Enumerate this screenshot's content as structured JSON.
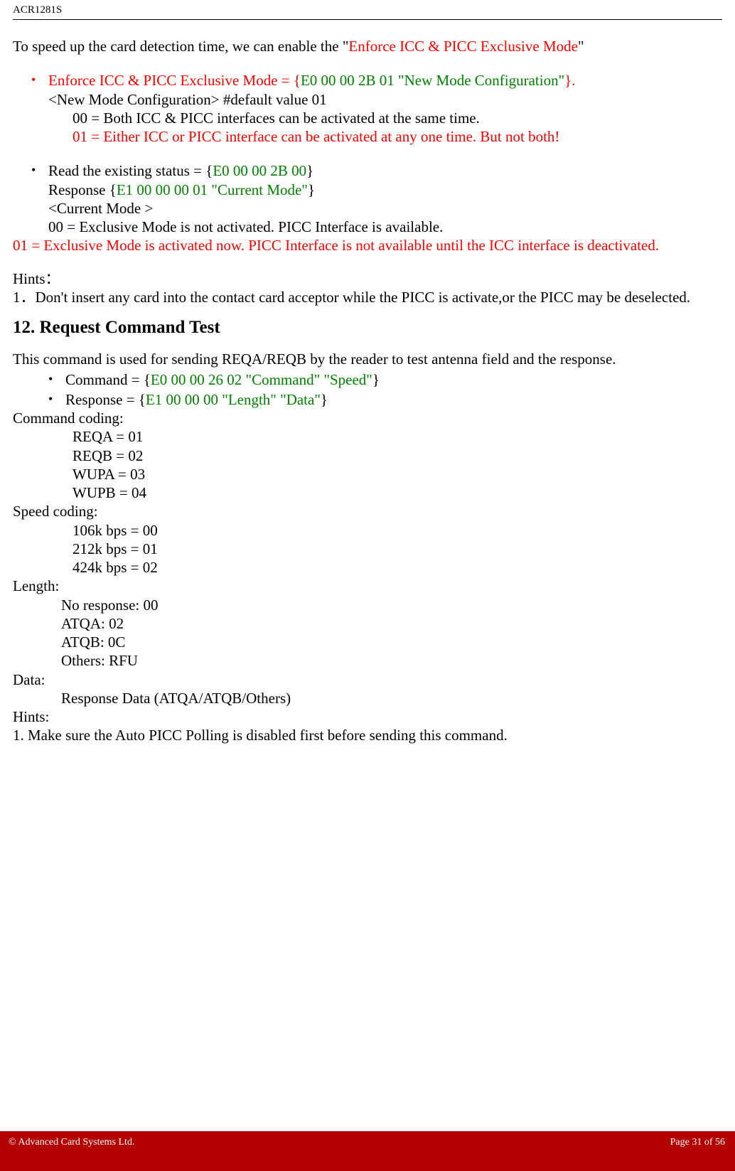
{
  "header": {
    "title": "ACR1281S"
  },
  "intro": {
    "prefix": "To speed up the card detection time, we can enable the \"",
    "mode_name": "Enforce ICC & PICC Exclusive Mode",
    "suffix": "\""
  },
  "b1": {
    "line1_red_a": "Enforce ICC & PICC Exclusive Mode = {",
    "line1_green": "E0 00 00 2B 01 \"New Mode Configuration\"",
    "line1_red_b": "}.",
    "conf_label": "<New Mode Configuration> #default value 01",
    "opt00": "00 = Both ICC & PICC interfaces can be activated at the same time.",
    "opt01": "01 = Either ICC or PICC interface can be activated at any one time. But not both!"
  },
  "b2": {
    "read_prefix": "Read the existing status = {",
    "read_code": "E0 00 00 2B 00",
    "read_suffix": "}",
    "resp_prefix": "Response {",
    "resp_code": "E1 00 00 00 01 \"Current Mode\"",
    "resp_suffix": "}",
    "cur_mode_label": "<Current Mode >",
    "opt00": "00 = Exclusive Mode is not activated. PICC Interface is available.",
    "opt01": "01 = Exclusive Mode is activated now. PICC Interface is not available until the ICC interface is deactivated."
  },
  "hints1": {
    "title": "Hints：",
    "item1": "1．Don't insert any card into the contact card acceptor while the PICC is activate,or the PICC may be deselected."
  },
  "section12": {
    "title": "12. Request Command Test",
    "intro": "This command is used for sending REQA/REQB by the reader to test antenna field and the response.",
    "cmd_prefix": "Command = {",
    "cmd_code": "E0 00 00 26 02 \"Command\" \"Speed\"",
    "cmd_suffix": "}",
    "resp_prefix": "Response = {",
    "resp_code": "E1 00 00 00 \"Length\" \"Data\"",
    "resp_suffix": "}",
    "cmd_coding_label": "Command coding:",
    "cmd_coding": [
      "REQA = 01",
      "REQB = 02",
      "WUPA = 03",
      "WUPB = 04"
    ],
    "speed_label": "Speed coding:",
    "speed_coding": [
      "106k bps = 00",
      "212k bps = 01",
      "424k bps = 02"
    ],
    "length_label": "Length:",
    "length_items": [
      "No response: 00",
      "ATQA: 02",
      "ATQB: 0C",
      "Others: RFU"
    ],
    "data_label": "Data:",
    "data_item": "Response Data (ATQA/ATQB/Others)",
    "hints_label": "Hints:",
    "hints_item": "1. Make sure the Auto PICC Polling is disabled first before sending this command."
  },
  "footer": {
    "left": "© Advanced Card Systems Ltd.",
    "right": "Page 31 of 56"
  }
}
